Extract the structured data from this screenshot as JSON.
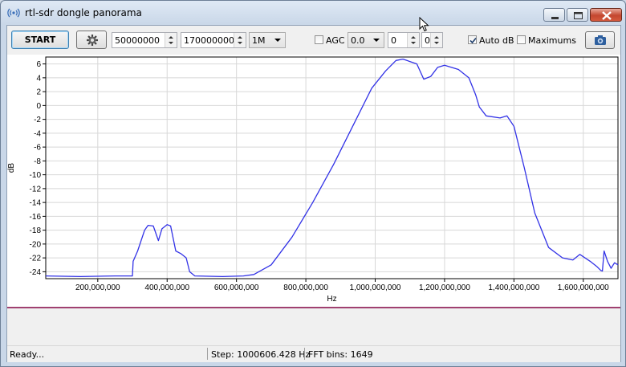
{
  "window": {
    "title": "rtl-sdr dongle panorama"
  },
  "toolbar": {
    "start_label": "START",
    "start_freq": "50000000",
    "end_freq": "1700000000",
    "step_option": "1M",
    "agc_label": "AGC",
    "agc_checked": false,
    "gain_value": "0.0",
    "spin_a": "0",
    "spin_b": "0",
    "auto_db_label": "Auto dB",
    "auto_db_checked": true,
    "maximums_label": "Maximums",
    "maximums_checked": false,
    "icons": [
      "gear-icon",
      "camera-icon"
    ]
  },
  "chart_data": {
    "type": "line",
    "xlabel": "Hz",
    "ylabel": "dB",
    "xlim": [
      50000000,
      1700000000
    ],
    "ylim": [
      -25,
      7
    ],
    "x_ticks": [
      200000000,
      400000000,
      600000000,
      800000000,
      1000000000,
      1200000000,
      1400000000,
      1600000000
    ],
    "x_tick_labels": [
      "200,000,000",
      "400,000,000",
      "600,000,000",
      "800,000,000",
      "1,000,000,000",
      "1,200,000,000",
      "1,400,000,000",
      "1,600,000,000"
    ],
    "y_ticks": [
      6,
      4,
      2,
      0,
      -2,
      -4,
      -6,
      -8,
      -10,
      -12,
      -14,
      -16,
      -18,
      -20,
      -22,
      -24
    ],
    "grid": true,
    "line_color": "#3232e6",
    "series": [
      {
        "x": [
          50000000,
          150000000,
          250000000,
          300000000,
          302000000,
          315000000,
          335000000,
          345000000,
          360000000,
          375000000,
          385000000,
          400000000,
          410000000,
          425000000,
          440000000,
          455000000,
          465000000,
          480000000,
          560000000,
          620000000,
          650000000,
          700000000,
          760000000,
          820000000,
          880000000,
          940000000,
          990000000,
          1030000000,
          1060000000,
          1080000000,
          1120000000,
          1140000000,
          1160000000,
          1180000000,
          1200000000,
          1240000000,
          1270000000,
          1290000000,
          1300000000,
          1320000000,
          1360000000,
          1380000000,
          1400000000,
          1430000000,
          1460000000,
          1500000000,
          1540000000,
          1570000000,
          1590000000,
          1620000000,
          1640000000,
          1650000000,
          1655000000,
          1660000000,
          1670000000,
          1680000000,
          1690000000,
          1700000000
        ],
        "y": [
          -24.6,
          -24.7,
          -24.6,
          -24.6,
          -22.5,
          -21,
          -18,
          -17.3,
          -17.4,
          -19.5,
          -17.8,
          -17.2,
          -17.4,
          -21,
          -21.4,
          -22,
          -24,
          -24.6,
          -24.7,
          -24.6,
          -24.4,
          -23,
          -19,
          -14,
          -8.5,
          -2.5,
          2.5,
          5,
          6.5,
          6.7,
          6,
          3.8,
          4.2,
          5.5,
          5.8,
          5.2,
          4,
          1.5,
          -0.2,
          -1.5,
          -1.8,
          -1.5,
          -3,
          -9,
          -15.5,
          -20.5,
          -22,
          -22.3,
          -21.5,
          -22.5,
          -23.3,
          -23.8,
          -23.9,
          -21,
          -22.5,
          -23.5,
          -22.7,
          -23
        ]
      }
    ]
  },
  "status": {
    "message": "Ready...",
    "step": "Step: 1000606.428 Hz",
    "fft_bins": "FFT bins: 1649"
  }
}
